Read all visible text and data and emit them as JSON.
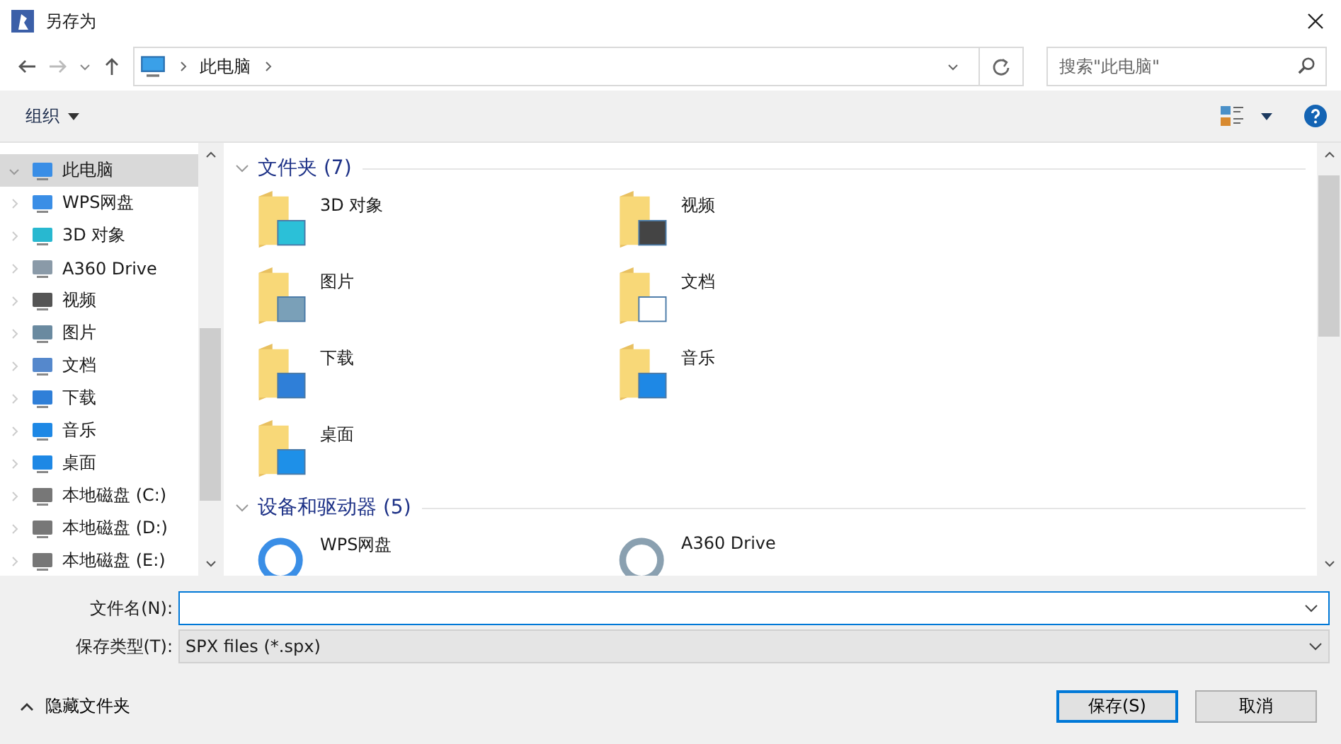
{
  "window": {
    "title": "另存为"
  },
  "address_bar": {
    "path": [
      "此电脑"
    ]
  },
  "search": {
    "placeholder": "搜索\"此电脑\""
  },
  "toolbar": {
    "organize": "组织"
  },
  "sidebar": {
    "items": [
      {
        "label": "此电脑",
        "selected": true,
        "expanded": true
      },
      {
        "label": "WPS网盘",
        "selected": false,
        "expanded": false
      },
      {
        "label": "3D 对象",
        "selected": false,
        "expanded": false
      },
      {
        "label": "A360 Drive",
        "selected": false,
        "expanded": false
      },
      {
        "label": "视频",
        "selected": false,
        "expanded": false
      },
      {
        "label": "图片",
        "selected": false,
        "expanded": false
      },
      {
        "label": "文档",
        "selected": false,
        "expanded": false
      },
      {
        "label": "下载",
        "selected": false,
        "expanded": false
      },
      {
        "label": "音乐",
        "selected": false,
        "expanded": false
      },
      {
        "label": "桌面",
        "selected": false,
        "expanded": false
      },
      {
        "label": "本地磁盘 (C:)",
        "selected": false,
        "expanded": false
      },
      {
        "label": "本地磁盘 (D:)",
        "selected": false,
        "expanded": false
      },
      {
        "label": "本地磁盘 (E:)",
        "selected": false,
        "expanded": false
      }
    ]
  },
  "sections": [
    {
      "title": "文件夹 (7)",
      "expanded": true,
      "items": [
        "3D 对象",
        "视频",
        "图片",
        "文档",
        "下载",
        "音乐",
        "桌面"
      ]
    },
    {
      "title": "设备和驱动器 (5)",
      "expanded": true,
      "items": [
        "WPS网盘",
        "A360 Drive"
      ]
    }
  ],
  "form": {
    "filename_label": "文件名(N):",
    "type_label": "保存类型(T):",
    "type_value": "SPX files (*.spx)"
  },
  "hide_folders": "隐藏文件夹",
  "buttons": [
    {
      "label": "保存(S)",
      "default": true
    },
    {
      "label": "取消",
      "default": false
    }
  ]
}
